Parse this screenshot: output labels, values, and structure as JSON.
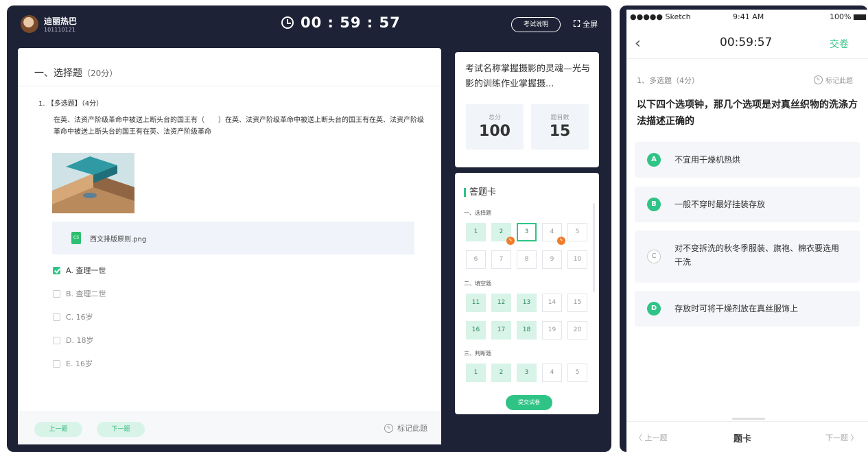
{
  "desktop": {
    "user": {
      "name": "迪丽热巴",
      "id": "101110121"
    },
    "timer": "00 : 59 : 57",
    "exam_desc_button": "考试说明",
    "fullscreen_label": "全屏",
    "section_title": "一、选择题",
    "section_points": "（20分）",
    "question_head": "1. 【多选题】（4分）",
    "question_text": "在英、法资产阶级革命中被送上断头台的国王有（　　）在英、法资产阶级革命中被送上断头台的国王有在英、法资产阶级革命中被送上断头台的国王有在英、法资产阶级革命",
    "attachment_name": "西文排版原则.png",
    "attachment_badge": "CS",
    "options": [
      {
        "label": "A. 查理一世",
        "checked": true
      },
      {
        "label": "B. 查理二世",
        "checked": false
      },
      {
        "label": "C. 16岁",
        "checked": false
      },
      {
        "label": "D. 18岁",
        "checked": false
      },
      {
        "label": "E. 16岁",
        "checked": false
      }
    ],
    "prev_button": "上一题",
    "next_button": "下一题",
    "mark_label": "标记此题",
    "exam_name": "考试名称掌握摄影的灵魂—光与影的训练作业掌握摄...",
    "total_score_label": "总分",
    "total_score": "100",
    "question_count_label": "题目数",
    "question_count": "15",
    "answer_card_title": "答题卡",
    "groups": [
      {
        "title": "一、选择题",
        "cells": [
          {
            "n": "1",
            "state": "done"
          },
          {
            "n": "2",
            "state": "done",
            "flag": true
          },
          {
            "n": "3",
            "state": "cur"
          },
          {
            "n": "4",
            "state": "todo",
            "flag": true
          },
          {
            "n": "5",
            "state": "todo"
          },
          {
            "n": "6",
            "state": "todo"
          },
          {
            "n": "7",
            "state": "todo"
          },
          {
            "n": "8",
            "state": "todo"
          },
          {
            "n": "9",
            "state": "todo"
          },
          {
            "n": "10",
            "state": "todo"
          }
        ]
      },
      {
        "title": "二、填空题",
        "cells": [
          {
            "n": "11",
            "state": "done"
          },
          {
            "n": "12",
            "state": "done"
          },
          {
            "n": "13",
            "state": "done"
          },
          {
            "n": "14",
            "state": "todo"
          },
          {
            "n": "15",
            "state": "todo"
          },
          {
            "n": "16",
            "state": "done"
          },
          {
            "n": "17",
            "state": "done"
          },
          {
            "n": "18",
            "state": "done"
          },
          {
            "n": "19",
            "state": "todo"
          },
          {
            "n": "20",
            "state": "todo"
          }
        ]
      },
      {
        "title": "三、判断题",
        "cells": [
          {
            "n": "1",
            "state": "done"
          },
          {
            "n": "2",
            "state": "done"
          },
          {
            "n": "3",
            "state": "done"
          },
          {
            "n": "4",
            "state": "todo"
          },
          {
            "n": "5",
            "state": "todo"
          }
        ]
      }
    ],
    "submit_button": "提交试卷"
  },
  "phone": {
    "carrier": "●●●●● Sketch",
    "time": "9:41 AM",
    "battery": "100%",
    "timer": "00:59:57",
    "hand_in": "交卷",
    "question_head": "1、多选题（4分）",
    "mark_label": "标记此题",
    "question_text": "以下四个选项钟，那几个选项是对真丝织物的洗涤方法描述正确的",
    "options": [
      {
        "badge": "A",
        "text": "不宜用干燥机热烘",
        "selected": true
      },
      {
        "badge": "B",
        "text": "一般不穿时最好挂装存放",
        "selected": true
      },
      {
        "badge": "C",
        "text": "对不变拆洗的秋冬季服装、旗袍、棉衣要选用干洗",
        "selected": false
      },
      {
        "badge": "D",
        "text": "存放时可将干燥剂放在真丝服饰上",
        "selected": true
      }
    ],
    "prev": "〈 上一题",
    "card": "题卡",
    "next": "下一题 〉"
  },
  "colors": {
    "accent": "#2fc486",
    "frame": "#1d2236",
    "flag": "#f07c2a"
  }
}
